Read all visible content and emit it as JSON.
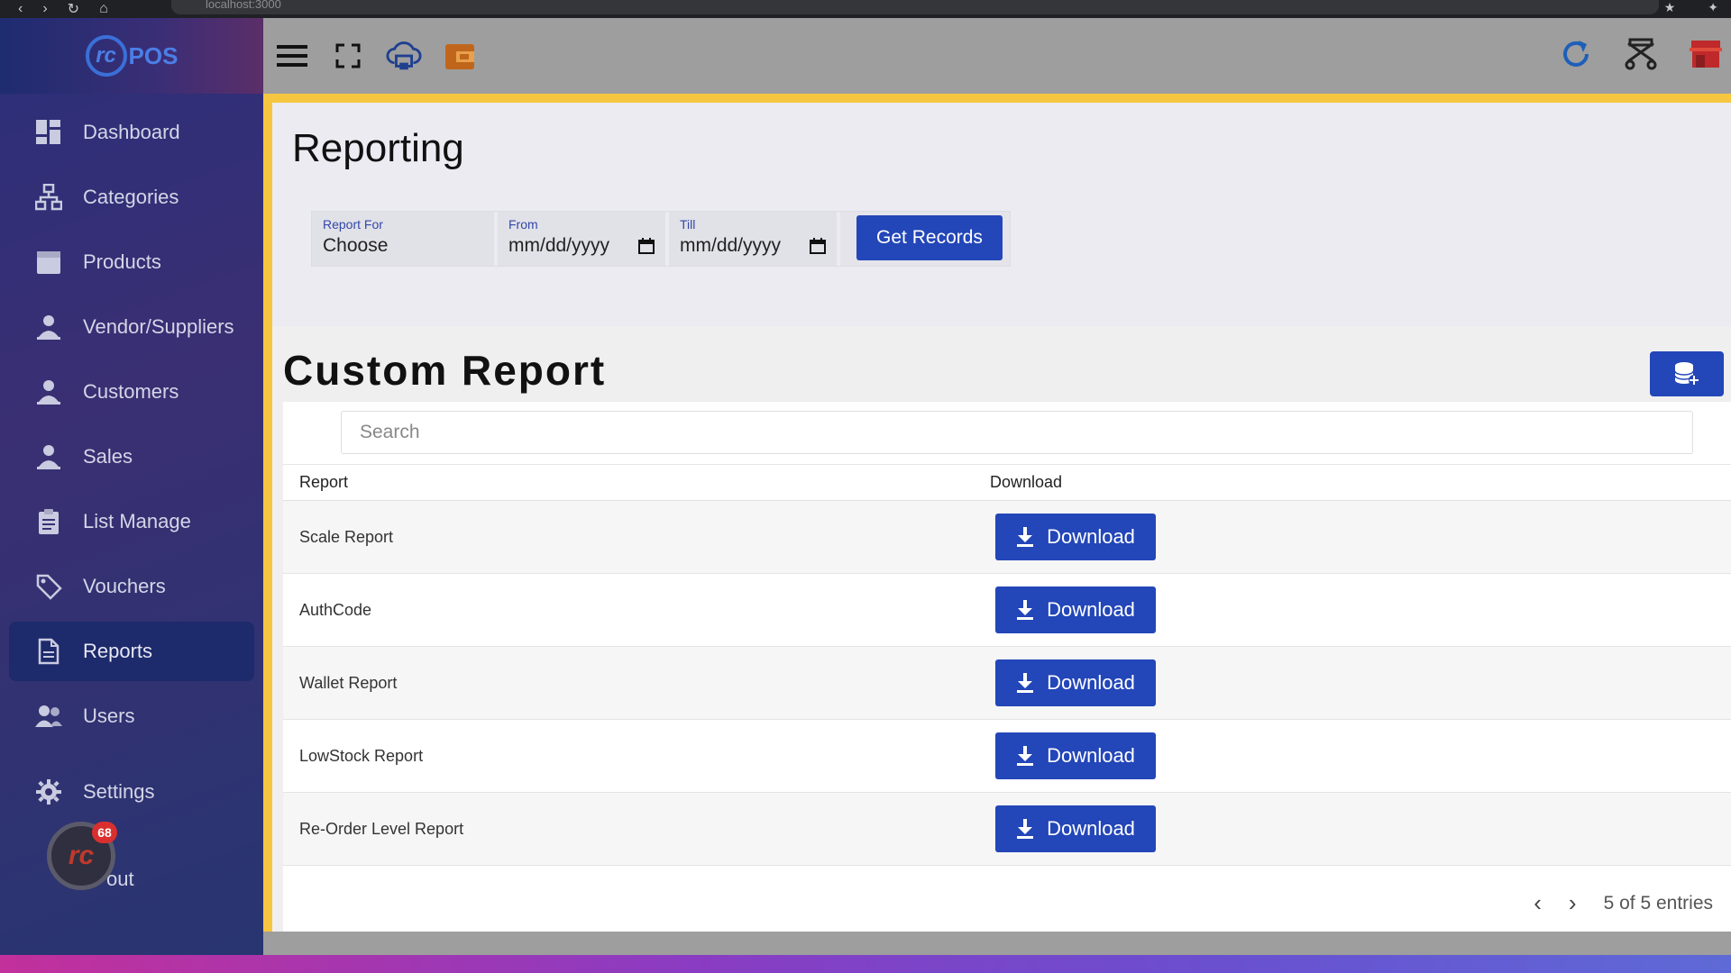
{
  "browser": {
    "url": "localhost:3000"
  },
  "app": {
    "logo_text": "rc",
    "logo_suffix": "POS"
  },
  "sidebar": {
    "items": [
      {
        "label": "Dashboard",
        "icon": "dashboard-icon"
      },
      {
        "label": "Categories",
        "icon": "sitemap-icon"
      },
      {
        "label": "Products",
        "icon": "box-icon"
      },
      {
        "label": "Vendor/Suppliers",
        "icon": "person-icon"
      },
      {
        "label": "Customers",
        "icon": "person-icon"
      },
      {
        "label": "Sales",
        "icon": "person-icon"
      },
      {
        "label": "List Manage",
        "icon": "clipboard-icon"
      },
      {
        "label": "Vouchers",
        "icon": "tag-icon"
      },
      {
        "label": "Reports",
        "icon": "file-icon",
        "active": true
      },
      {
        "label": "Users",
        "icon": "users-icon"
      },
      {
        "label": "Settings",
        "icon": "gear-icon"
      }
    ],
    "logout_partial": "out",
    "notification_count": "68"
  },
  "page": {
    "title": "Reporting",
    "filters": {
      "report_for_label": "Report For",
      "report_for_value": "Choose",
      "from_label": "From",
      "from_value": "mm/dd/yyyy",
      "till_label": "Till",
      "till_value": "mm/dd/yyyy",
      "get_records_label": "Get Records"
    }
  },
  "custom_report": {
    "title": "Custom Report",
    "search_placeholder": "Search",
    "columns": {
      "report": "Report",
      "download": "Download"
    },
    "rows": [
      {
        "report": "Scale Report",
        "button": "Download"
      },
      {
        "report": "AuthCode",
        "button": "Download"
      },
      {
        "report": "Wallet Report",
        "button": "Download"
      },
      {
        "report": "LowStock Report",
        "button": "Download"
      },
      {
        "report": "Re-Order Level Report",
        "button": "Download"
      }
    ],
    "pagination": "5 of 5 entries"
  },
  "colors": {
    "primary": "#2346b8",
    "frame": "#f6c640",
    "sidebar": "#2b2f7a"
  }
}
